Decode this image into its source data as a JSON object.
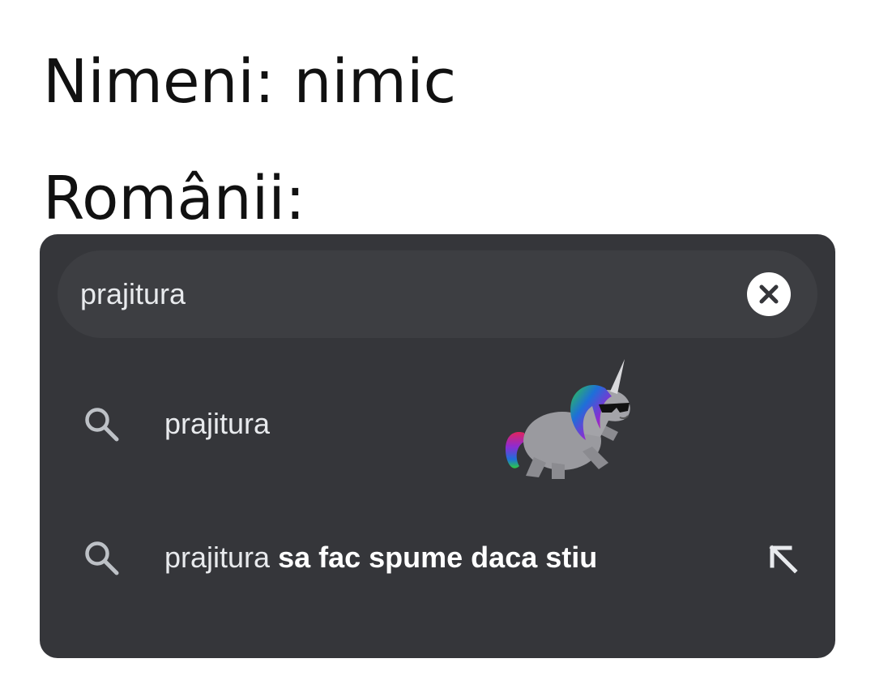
{
  "meme": {
    "line1": "Nimeni: nimic",
    "line2": "Românii:"
  },
  "search": {
    "query": "prajitura",
    "clear_icon": "clear-x-icon"
  },
  "suggestions": [
    {
      "icon": "search-icon",
      "text": "prajitura",
      "completion": ""
    },
    {
      "icon": "search-icon",
      "text": "prajitura",
      "completion": " sa fac spume daca stiu",
      "action_icon": "arrow-up-left-icon"
    }
  ],
  "watermark": {
    "icon": "unicorn-sunglasses-logo"
  },
  "colors": {
    "panel_bg": "#35363a",
    "search_bg": "#3d3e42",
    "text": "#e8eaed",
    "icon": "#bdc1c6"
  }
}
